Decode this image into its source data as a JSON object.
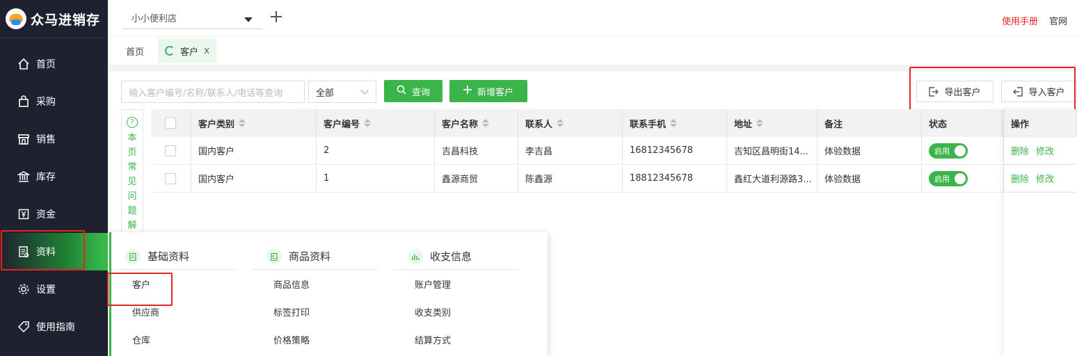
{
  "app": {
    "title": "众马进销存"
  },
  "nav": [
    {
      "key": "home",
      "label": "首页",
      "icon": "home-icon"
    },
    {
      "key": "purchase",
      "label": "采购",
      "icon": "bag-icon"
    },
    {
      "key": "sales",
      "label": "销售",
      "icon": "store-icon"
    },
    {
      "key": "stock",
      "label": "库存",
      "icon": "bank-icon"
    },
    {
      "key": "funds",
      "label": "资金",
      "icon": "yen-icon"
    },
    {
      "key": "data",
      "label": "资料",
      "icon": "document-icon",
      "active": true
    },
    {
      "key": "settings",
      "label": "设置",
      "icon": "gear-icon"
    },
    {
      "key": "guide",
      "label": "使用指南",
      "icon": "tag-icon"
    }
  ],
  "header": {
    "store": "小小便利店",
    "manual_link": "使用手册",
    "site_link": "官网"
  },
  "tabs": {
    "home": "首页",
    "customer": "客户",
    "close": "x"
  },
  "toolbar": {
    "search_placeholder": "输入客户编号/名称/联系人/电话等查询",
    "type_value": "全部",
    "query_label": "查询",
    "add_label": "新增客户",
    "export_label": "导出客户",
    "import_label": "导入客户"
  },
  "faq": {
    "chars": [
      "本",
      "页",
      "常",
      "见",
      "问",
      "题",
      "解"
    ]
  },
  "table": {
    "headers": [
      "客户类别",
      "客户编号",
      "客户名称",
      "联系人",
      "联系手机",
      "地址",
      "备注",
      "状态",
      "操作"
    ],
    "rows": [
      {
        "type": "国内客户",
        "code": "2",
        "name": "吉昌科技",
        "contact": "李吉昌",
        "phone": "16812345678",
        "addr": "吉知区昌明街14...",
        "remark": "体验数据",
        "status": "启用"
      },
      {
        "type": "国内客户",
        "code": "1",
        "name": "鑫源商贸",
        "contact": "陈鑫源",
        "phone": "18812345678",
        "addr": "鑫红大道利源路3...",
        "remark": "体验数据",
        "status": "启用"
      }
    ],
    "op_delete": "删除",
    "op_edit": "修改"
  },
  "panel": {
    "basic": {
      "title": "基础资料",
      "items": [
        "客户",
        "供应商",
        "仓库"
      ]
    },
    "goods": {
      "title": "商品资料",
      "items": [
        "商品信息",
        "标签打印",
        "价格策略"
      ]
    },
    "finance": {
      "title": "收支信息",
      "items": [
        "账户管理",
        "收支类别",
        "结算方式"
      ]
    }
  },
  "colors": {
    "sidebar": "#1f2130",
    "accent": "#3bb54a",
    "highlight": "#e8231e"
  }
}
